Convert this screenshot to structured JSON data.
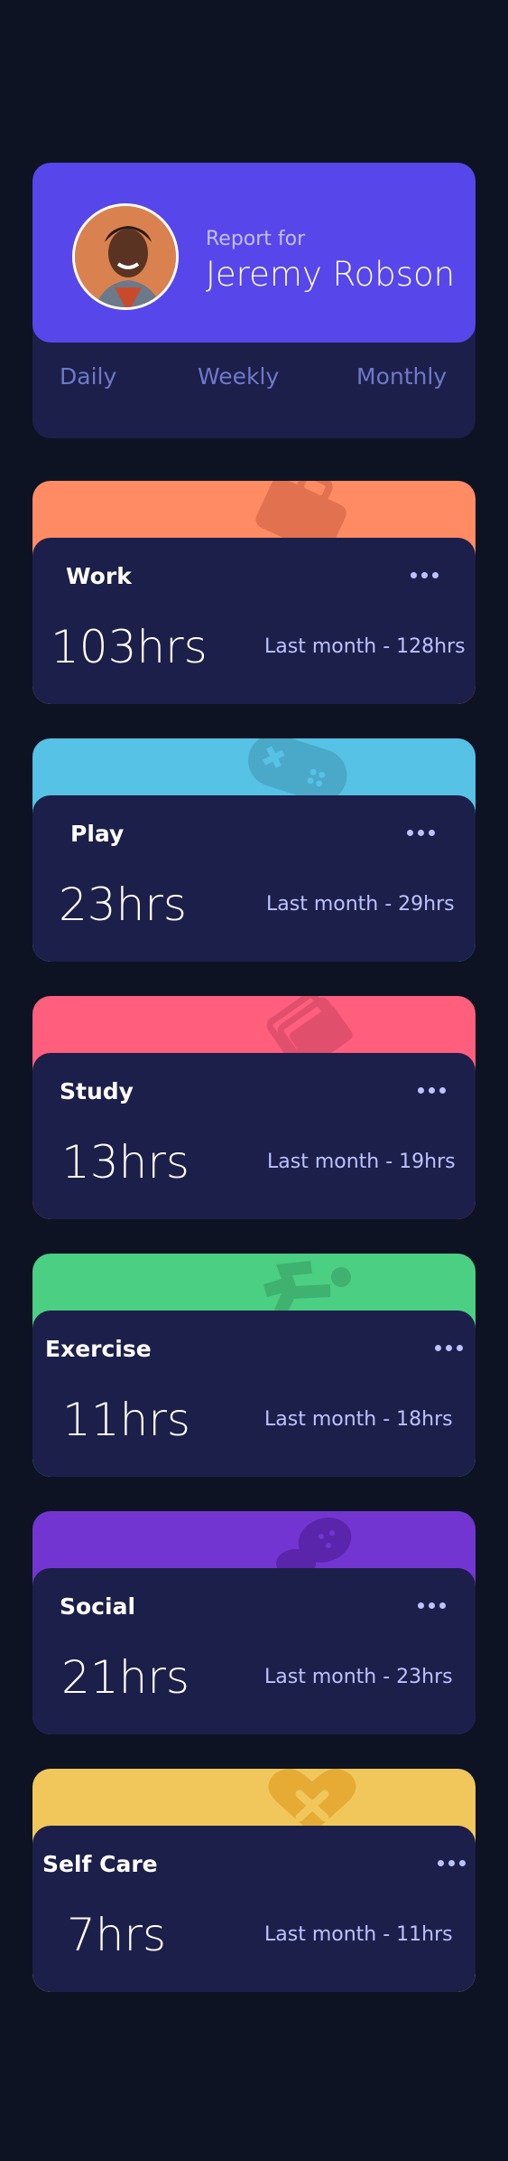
{
  "profile": {
    "report_for": "Report for",
    "name": "Jeremy Robson",
    "periods": [
      "Daily",
      "Weekly",
      "Monthly"
    ]
  },
  "colors": {
    "background": "#0d1323",
    "card": "#1c1f4a",
    "profile_accent": "#5747ea",
    "work": "#ff8b64",
    "play": "#55c2e6",
    "study": "#ff5e7d",
    "exercise": "#4bcf82",
    "social": "#7335d2",
    "self_care": "#f1c75b"
  },
  "cards": [
    {
      "title": "Work",
      "hours": "103hrs",
      "last": "Last month - 128hrs",
      "icon": "briefcase-icon"
    },
    {
      "title": "Play",
      "hours": "23hrs",
      "last": "Last month - 29hrs",
      "icon": "gamepad-icon"
    },
    {
      "title": "Study",
      "hours": "13hrs",
      "last": "Last month - 19hrs",
      "icon": "books-icon"
    },
    {
      "title": "Exercise",
      "hours": "11hrs",
      "last": "Last month - 18hrs",
      "icon": "running-icon"
    },
    {
      "title": "Social",
      "hours": "21hrs",
      "last": "Last month - 23hrs",
      "icon": "social-icon"
    },
    {
      "title": "Self Care",
      "hours": "7hrs",
      "last": "Last month - 11hrs",
      "icon": "heart-icon"
    }
  ]
}
